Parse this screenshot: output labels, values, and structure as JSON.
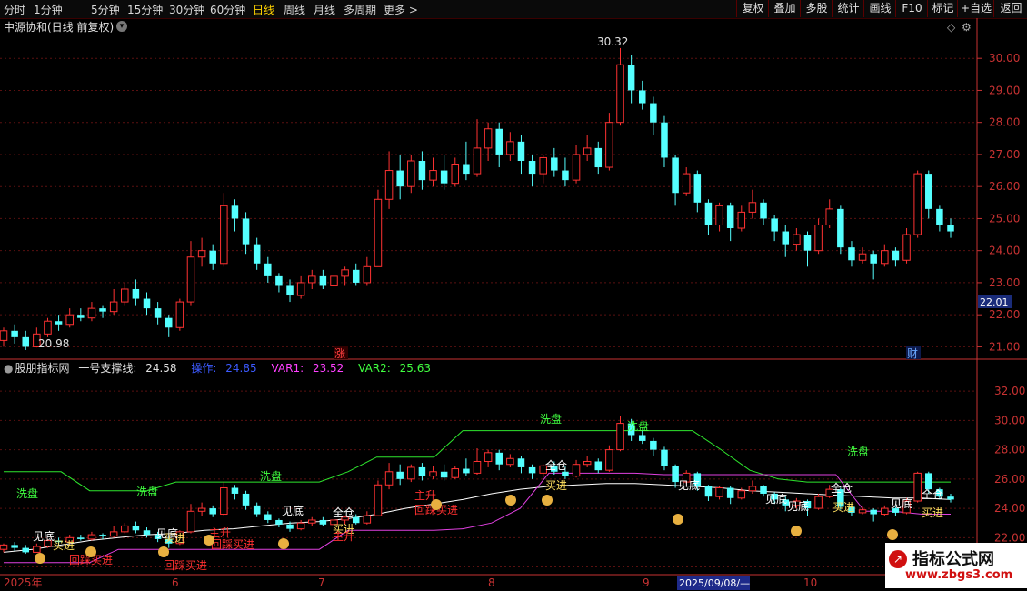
{
  "toolbar": {
    "periods": [
      "分时",
      "1分钟",
      "5分钟",
      "15分钟",
      "30分钟",
      "60分钟",
      "日线",
      "周线",
      "月线",
      "多周期",
      "更多 >"
    ],
    "active_period": "日线",
    "right_buttons": [
      "复权",
      "叠加",
      "多股",
      "统计",
      "画线",
      "F10",
      "标记",
      "+自选",
      "返回"
    ]
  },
  "main_title": "中源协和(日线 前复权)",
  "price_chart": {
    "high_label": "30.32",
    "low_label": "20.98",
    "current_price_label": "22.01",
    "marker_zhang": "涨",
    "marker_cai": "财",
    "y_ticks": [
      "30.00",
      "29.00",
      "28.00",
      "27.00",
      "26.00",
      "25.00",
      "24.00",
      "23.00",
      "22.00",
      "21.00"
    ]
  },
  "indicator": {
    "name": "股朋指标网",
    "line1_label": "一号支撑线:",
    "line1_value": "24.58",
    "line2_label": "操作:",
    "line2_value": "24.85",
    "line3_label": "VAR1:",
    "line3_value": "23.52",
    "line4_label": "VAR2:",
    "line4_value": "25.63",
    "y_ticks": [
      "32.00",
      "30.00",
      "28.00",
      "26.00",
      "24.00",
      "22.00",
      "20.00"
    ],
    "signals": [
      "洗盘",
      "洗盘",
      "洗盘",
      "洗盘",
      "洗盘",
      "洗盘",
      "见底",
      "买进",
      "回踩买进",
      "见底",
      "全仓",
      "买进",
      "回踩买进",
      "主升",
      "回踩买进",
      "见底",
      "全仓",
      "买进",
      "主升",
      "主升",
      "回踩买进",
      "买进",
      "见底",
      "见底",
      "见底",
      "买进",
      "全仓",
      "见底",
      "全仓",
      "买进"
    ]
  },
  "time_axis": {
    "labels": [
      "2025年",
      "6",
      "7",
      "8",
      "9",
      "2025/09/08/—",
      "10"
    ]
  },
  "watermark": {
    "title": "指标公式网",
    "url": "www.zbgs3.com"
  },
  "colors": {
    "up": "#ff3232",
    "down": "#54ffff",
    "axis": "#c83232",
    "grid": "#5a1010"
  },
  "chart_data": {
    "type": "candlestick",
    "title": "中源协和(日线 前复权)",
    "ylim": [
      20.7,
      30.8
    ],
    "indicator_ylim": [
      19.6,
      33.0
    ],
    "candles": [
      {
        "o": 21.2,
        "c": 21.5,
        "h": 21.6,
        "l": 21.0
      },
      {
        "o": 21.5,
        "c": 21.3,
        "h": 21.7,
        "l": 21.1
      },
      {
        "o": 21.3,
        "c": 21.0,
        "h": 21.5,
        "l": 20.9
      },
      {
        "o": 21.0,
        "c": 21.4,
        "h": 21.6,
        "l": 20.98
      },
      {
        "o": 21.4,
        "c": 21.8,
        "h": 21.9,
        "l": 21.3
      },
      {
        "o": 21.8,
        "c": 21.7,
        "h": 22.0,
        "l": 21.5
      },
      {
        "o": 21.7,
        "c": 22.0,
        "h": 22.2,
        "l": 21.6
      },
      {
        "o": 22.0,
        "c": 21.9,
        "h": 22.2,
        "l": 21.8
      },
      {
        "o": 21.9,
        "c": 22.2,
        "h": 22.4,
        "l": 21.8
      },
      {
        "o": 22.2,
        "c": 22.1,
        "h": 22.3,
        "l": 21.9
      },
      {
        "o": 22.1,
        "c": 22.4,
        "h": 22.8,
        "l": 22.0
      },
      {
        "o": 22.4,
        "c": 22.8,
        "h": 23.0,
        "l": 22.3
      },
      {
        "o": 22.8,
        "c": 22.5,
        "h": 23.1,
        "l": 22.3
      },
      {
        "o": 22.5,
        "c": 22.2,
        "h": 22.7,
        "l": 22.0
      },
      {
        "o": 22.2,
        "c": 21.9,
        "h": 22.4,
        "l": 21.7
      },
      {
        "o": 21.9,
        "c": 21.6,
        "h": 22.0,
        "l": 21.3
      },
      {
        "o": 21.6,
        "c": 22.4,
        "h": 22.5,
        "l": 21.5
      },
      {
        "o": 22.4,
        "c": 23.8,
        "h": 24.3,
        "l": 22.3
      },
      {
        "o": 23.8,
        "c": 24.0,
        "h": 24.4,
        "l": 23.5
      },
      {
        "o": 24.0,
        "c": 23.6,
        "h": 24.2,
        "l": 23.4
      },
      {
        "o": 23.6,
        "c": 25.4,
        "h": 25.8,
        "l": 23.5
      },
      {
        "o": 25.4,
        "c": 25.0,
        "h": 25.6,
        "l": 24.6
      },
      {
        "o": 25.0,
        "c": 24.2,
        "h": 25.2,
        "l": 23.9
      },
      {
        "o": 24.2,
        "c": 23.6,
        "h": 24.4,
        "l": 23.4
      },
      {
        "o": 23.6,
        "c": 23.2,
        "h": 23.8,
        "l": 23.0
      },
      {
        "o": 23.2,
        "c": 22.9,
        "h": 23.3,
        "l": 22.7
      },
      {
        "o": 22.9,
        "c": 22.6,
        "h": 23.1,
        "l": 22.4
      },
      {
        "o": 22.6,
        "c": 23.0,
        "h": 23.2,
        "l": 22.5
      },
      {
        "o": 23.0,
        "c": 23.2,
        "h": 23.4,
        "l": 22.8
      },
      {
        "o": 23.2,
        "c": 22.9,
        "h": 23.4,
        "l": 22.8
      },
      {
        "o": 22.9,
        "c": 23.2,
        "h": 23.4,
        "l": 22.8
      },
      {
        "o": 23.2,
        "c": 23.4,
        "h": 23.5,
        "l": 22.9
      },
      {
        "o": 23.4,
        "c": 23.0,
        "h": 23.6,
        "l": 22.9
      },
      {
        "o": 23.0,
        "c": 23.5,
        "h": 23.8,
        "l": 22.9
      },
      {
        "o": 23.5,
        "c": 25.6,
        "h": 25.9,
        "l": 24.5
      },
      {
        "o": 25.6,
        "c": 26.5,
        "h": 27.1,
        "l": 25.3
      },
      {
        "o": 26.5,
        "c": 26.0,
        "h": 27.0,
        "l": 25.6
      },
      {
        "o": 26.0,
        "c": 26.8,
        "h": 27.0,
        "l": 25.8
      },
      {
        "o": 26.8,
        "c": 26.2,
        "h": 27.1,
        "l": 25.9
      },
      {
        "o": 26.2,
        "c": 26.5,
        "h": 26.9,
        "l": 26.0
      },
      {
        "o": 26.5,
        "c": 26.1,
        "h": 27.0,
        "l": 25.9
      },
      {
        "o": 26.1,
        "c": 26.7,
        "h": 26.9,
        "l": 26.0
      },
      {
        "o": 26.7,
        "c": 26.4,
        "h": 27.4,
        "l": 26.2
      },
      {
        "o": 26.4,
        "c": 27.2,
        "h": 28.1,
        "l": 26.3
      },
      {
        "o": 27.2,
        "c": 27.8,
        "h": 28.0,
        "l": 26.8
      },
      {
        "o": 27.8,
        "c": 27.0,
        "h": 28.0,
        "l": 26.6
      },
      {
        "o": 27.0,
        "c": 27.4,
        "h": 27.7,
        "l": 26.8
      },
      {
        "o": 27.4,
        "c": 26.8,
        "h": 27.6,
        "l": 26.4
      },
      {
        "o": 26.8,
        "c": 26.4,
        "h": 27.0,
        "l": 26.0
      },
      {
        "o": 26.4,
        "c": 26.9,
        "h": 27.0,
        "l": 26.1
      },
      {
        "o": 26.9,
        "c": 26.5,
        "h": 27.2,
        "l": 26.3
      },
      {
        "o": 26.5,
        "c": 26.2,
        "h": 26.9,
        "l": 26.0
      },
      {
        "o": 26.2,
        "c": 27.0,
        "h": 27.3,
        "l": 26.1
      },
      {
        "o": 27.0,
        "c": 27.2,
        "h": 27.6,
        "l": 26.8
      },
      {
        "o": 27.2,
        "c": 26.6,
        "h": 27.4,
        "l": 26.4
      },
      {
        "o": 26.6,
        "c": 28.0,
        "h": 28.3,
        "l": 26.5
      },
      {
        "o": 28.0,
        "c": 29.8,
        "h": 30.32,
        "l": 27.9
      },
      {
        "o": 29.8,
        "c": 29.0,
        "h": 30.1,
        "l": 28.6
      },
      {
        "o": 29.0,
        "c": 28.6,
        "h": 29.3,
        "l": 28.4
      },
      {
        "o": 28.6,
        "c": 28.0,
        "h": 28.8,
        "l": 27.6
      },
      {
        "o": 28.0,
        "c": 26.9,
        "h": 28.2,
        "l": 26.6
      },
      {
        "o": 26.9,
        "c": 25.8,
        "h": 27.0,
        "l": 25.4
      },
      {
        "o": 25.8,
        "c": 26.4,
        "h": 26.6,
        "l": 25.7
      },
      {
        "o": 26.4,
        "c": 25.5,
        "h": 26.5,
        "l": 25.2
      },
      {
        "o": 25.5,
        "c": 24.8,
        "h": 25.6,
        "l": 24.5
      },
      {
        "o": 24.8,
        "c": 25.4,
        "h": 25.5,
        "l": 24.6
      },
      {
        "o": 25.4,
        "c": 24.7,
        "h": 25.5,
        "l": 24.3
      },
      {
        "o": 24.7,
        "c": 25.2,
        "h": 25.4,
        "l": 24.6
      },
      {
        "o": 25.2,
        "c": 25.5,
        "h": 25.9,
        "l": 25.0
      },
      {
        "o": 25.5,
        "c": 25.0,
        "h": 25.6,
        "l": 24.8
      },
      {
        "o": 25.0,
        "c": 24.6,
        "h": 25.1,
        "l": 24.3
      },
      {
        "o": 24.6,
        "c": 24.2,
        "h": 24.8,
        "l": 23.8
      },
      {
        "o": 24.2,
        "c": 24.5,
        "h": 24.7,
        "l": 24.0
      },
      {
        "o": 24.5,
        "c": 24.0,
        "h": 24.6,
        "l": 23.5
      },
      {
        "o": 24.0,
        "c": 24.8,
        "h": 25.0,
        "l": 23.9
      },
      {
        "o": 24.8,
        "c": 25.3,
        "h": 25.6,
        "l": 24.7
      },
      {
        "o": 25.3,
        "c": 24.1,
        "h": 25.4,
        "l": 23.9
      },
      {
        "o": 24.1,
        "c": 23.7,
        "h": 24.3,
        "l": 23.5
      },
      {
        "o": 23.7,
        "c": 23.9,
        "h": 24.1,
        "l": 23.6
      },
      {
        "o": 23.9,
        "c": 23.6,
        "h": 24.0,
        "l": 23.1
      },
      {
        "o": 23.6,
        "c": 24.0,
        "h": 24.2,
        "l": 23.5
      },
      {
        "o": 24.0,
        "c": 23.7,
        "h": 24.1,
        "l": 23.5
      },
      {
        "o": 23.7,
        "c": 24.5,
        "h": 24.7,
        "l": 23.6
      },
      {
        "o": 24.5,
        "c": 26.4,
        "h": 26.5,
        "l": 24.4
      },
      {
        "o": 26.4,
        "c": 25.3,
        "h": 26.5,
        "l": 25.0
      },
      {
        "o": 25.3,
        "c": 24.8,
        "h": 25.4,
        "l": 24.6
      },
      {
        "o": 24.8,
        "c": 24.6,
        "h": 25.0,
        "l": 24.4
      }
    ],
    "support_line": [
      21.0,
      21.2,
      21.5,
      21.8,
      22.0,
      22.2,
      22.3,
      22.5,
      22.6,
      22.8,
      23.0,
      23.1,
      23.3,
      23.6,
      24.0,
      24.3,
      24.6,
      25.0,
      25.3,
      25.5,
      25.6,
      25.7,
      25.7,
      25.6,
      25.5,
      25.4,
      25.2,
      25.1,
      25.0,
      24.9,
      24.8,
      24.7,
      24.7,
      24.6
    ],
    "var1_line": [
      20.3,
      20.3,
      20.3,
      20.3,
      21.2,
      21.2,
      21.2,
      21.2,
      21.2,
      21.2,
      21.2,
      21.2,
      22.5,
      22.5,
      22.5,
      22.5,
      22.6,
      23.0,
      24.0,
      26.4,
      26.4,
      26.4,
      26.4,
      26.3,
      26.3,
      26.3,
      26.3,
      26.3,
      26.3,
      26.3,
      23.8,
      23.8,
      23.6,
      23.6
    ],
    "var2_line": [
      26.5,
      26.5,
      26.5,
      25.2,
      25.2,
      25.2,
      25.8,
      25.8,
      25.8,
      25.8,
      25.8,
      25.8,
      26.5,
      27.5,
      27.5,
      27.5,
      29.3,
      29.3,
      29.3,
      29.3,
      29.3,
      29.3,
      29.3,
      29.3,
      29.3,
      28.0,
      26.6,
      26.0,
      25.8,
      25.8,
      25.8,
      25.8,
      25.8,
      25.8
    ]
  }
}
